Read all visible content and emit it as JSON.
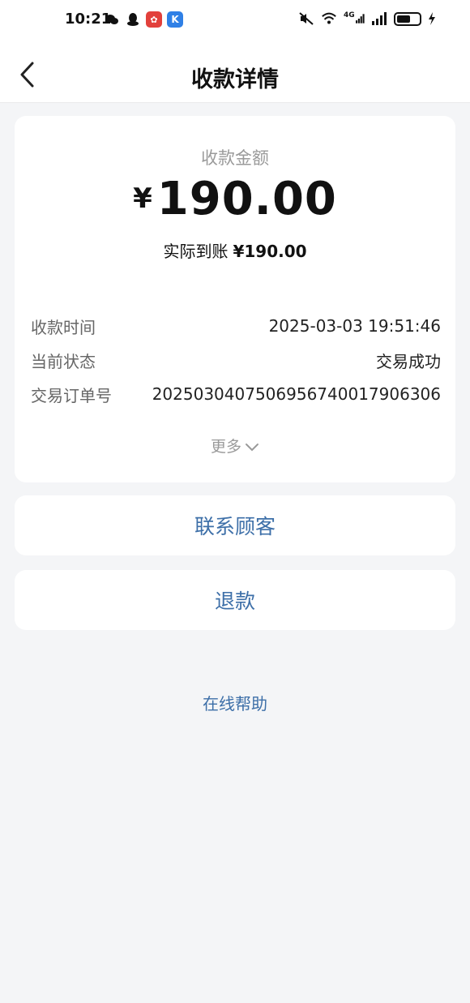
{
  "status_bar": {
    "time": "10:21",
    "network": "4G",
    "left_icons": [
      "wechat-icon",
      "qq-icon",
      "app-red-icon",
      "app-k-icon"
    ],
    "right_icons": [
      "mute-icon",
      "wifi-icon",
      "signal-icon",
      "signal-icon",
      "battery-icon",
      "charging-icon"
    ]
  },
  "header": {
    "title": "收款详情",
    "back_icon": "chevron-left-icon"
  },
  "summary": {
    "label": "收款金额",
    "currency": "¥",
    "amount": "190.00",
    "actual_label": "实际到账",
    "actual_amount": "¥190.00"
  },
  "details": [
    {
      "label": "收款时间",
      "value": "2025-03-03 19:51:46"
    },
    {
      "label": "当前状态",
      "value": "交易成功"
    },
    {
      "label": "交易订单号",
      "value": "2025030407506956740017906306"
    }
  ],
  "more": {
    "label": "更多",
    "icon": "chevron-down-icon"
  },
  "actions": {
    "contact": "联系顾客",
    "refund": "退款"
  },
  "help": {
    "label": "在线帮助"
  },
  "colors": {
    "background": "#f4f5f7",
    "card": "#ffffff",
    "link": "#3d6fa8",
    "muted": "#9a9a9a"
  }
}
